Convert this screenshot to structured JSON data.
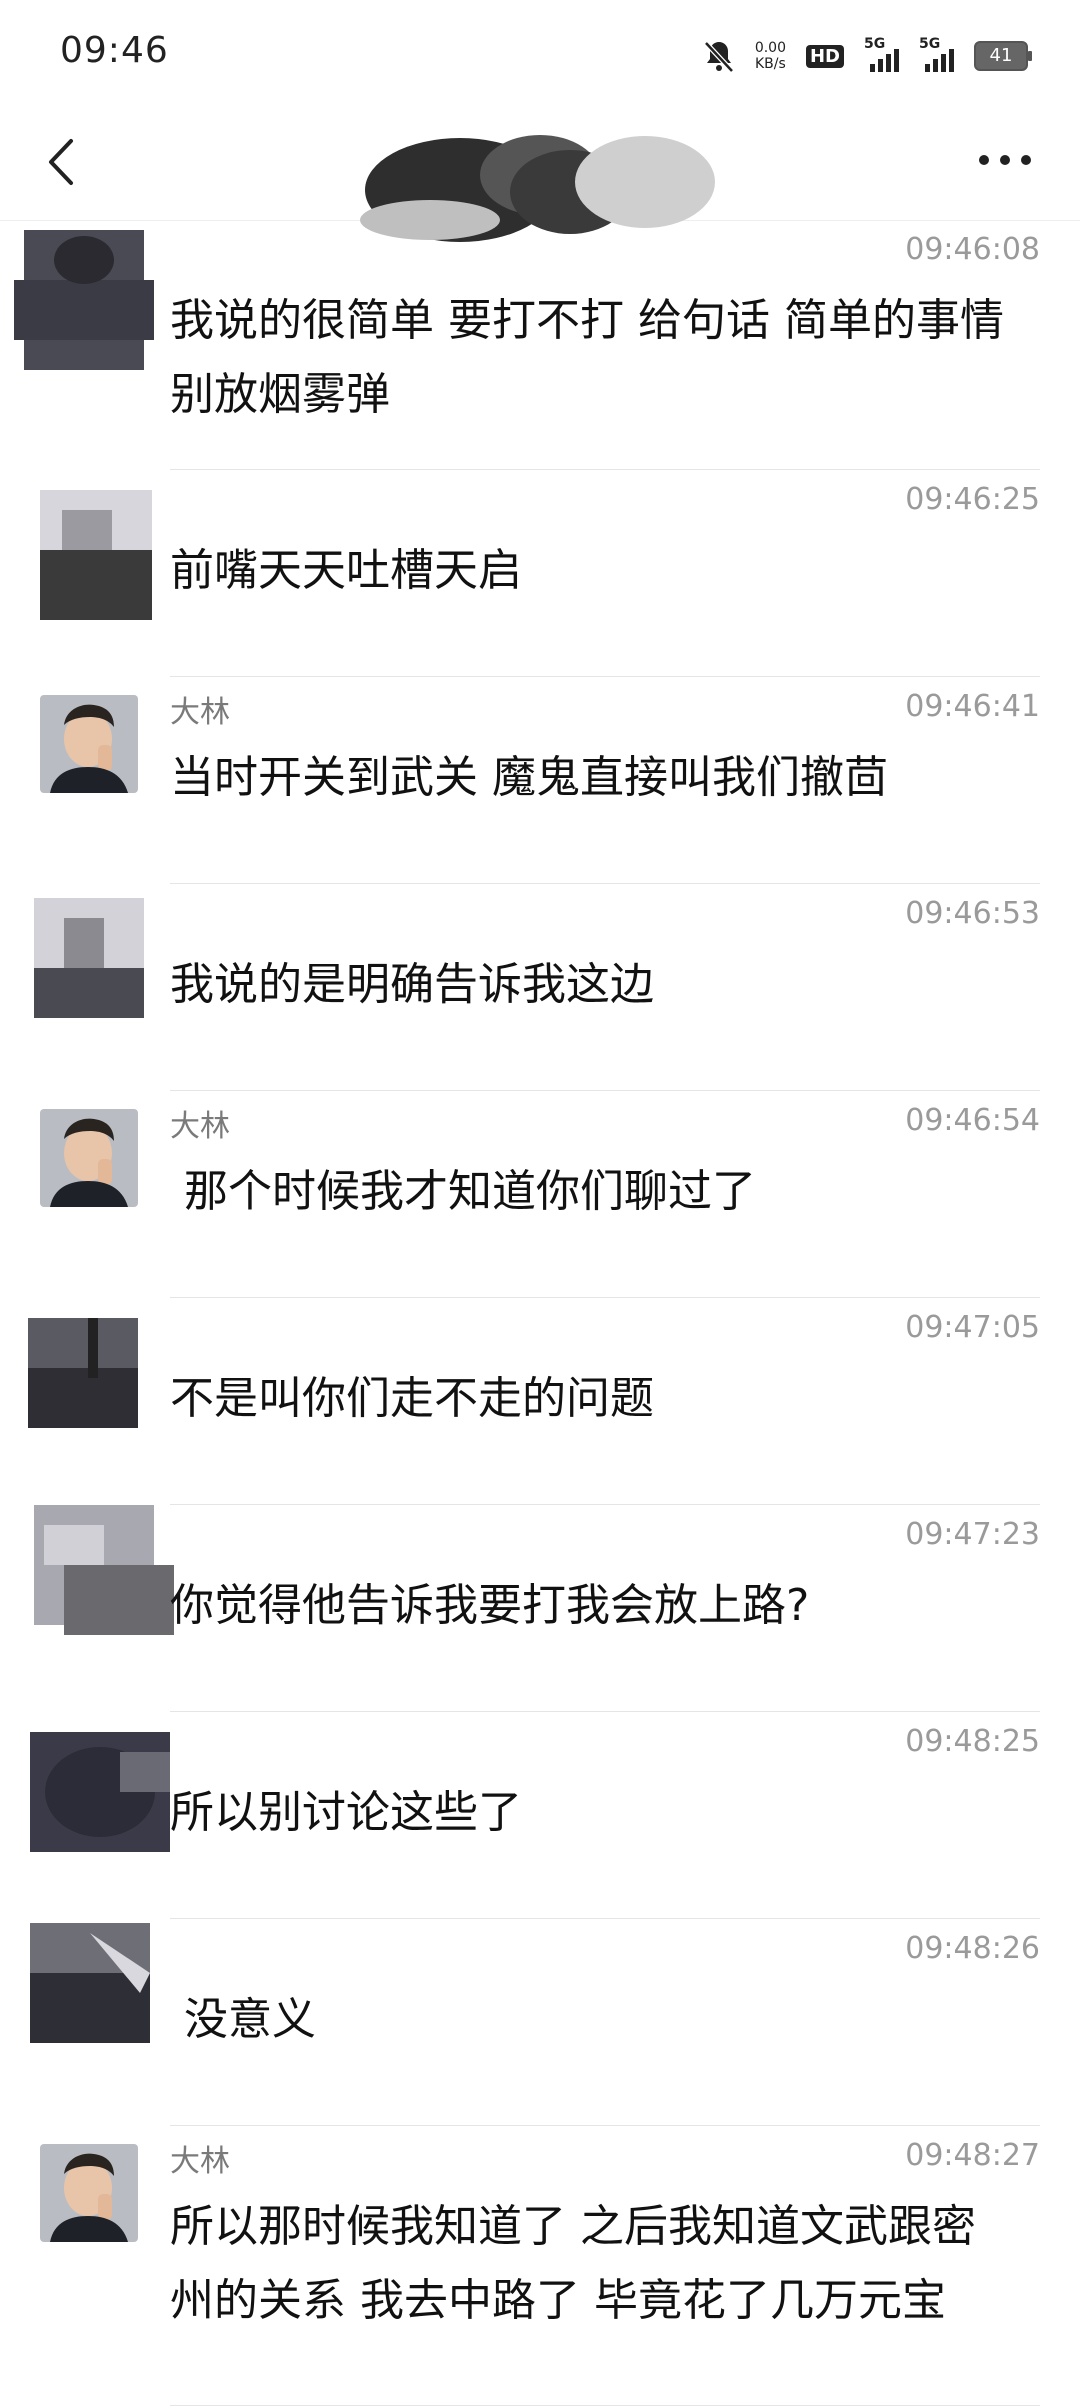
{
  "status_bar": {
    "time": "09:46",
    "net_speed": "0.00",
    "net_unit": "KB/s",
    "hd_label": "HD",
    "sim1_label": "5G",
    "sim2_label": "5G",
    "battery_level": "41"
  },
  "header": {
    "title_obscured": true,
    "back_icon": "chevron-left-icon",
    "more_icon": "more-horizontal-icon"
  },
  "messages": [
    {
      "name": "",
      "time": "09:46:08",
      "text": "我说的很简单 要打不打 给句话 简单的事情\n别放烟雾弹",
      "avatar": "scribbled"
    },
    {
      "name": "",
      "time": "09:46:25",
      "text": "前嘴天天吐槽天启",
      "avatar": "scribbled"
    },
    {
      "name": "大林",
      "time": "09:46:41",
      "text": "当时开关到武关 魔鬼直接叫我们撤茴",
      "avatar": "photo"
    },
    {
      "name": "",
      "time": "09:46:53",
      "text": "我说的是明确告诉我这边",
      "avatar": "scribbled"
    },
    {
      "name": "大林",
      "time": "09:46:54",
      "text": " 那个时候我才知道你们聊过了",
      "avatar": "photo"
    },
    {
      "name": "",
      "time": "09:47:05",
      "text": "不是叫你们走不走的问题",
      "avatar": "scribbled"
    },
    {
      "name": "",
      "time": "09:47:23",
      "text": "你觉得他告诉我要打我会放上路?",
      "avatar": "scribbled"
    },
    {
      "name": "",
      "time": "09:48:25",
      "text": "所以别讨论这些了",
      "avatar": "scribbled"
    },
    {
      "name": "",
      "time": "09:48:26",
      "text": " 没意义",
      "avatar": "scribbled"
    },
    {
      "name": "大林",
      "time": "09:48:27",
      "text": "所以那时候我知道了 之后我知道文武跟密\n州的关系 我去中路了 毕竟花了几万元宝",
      "avatar": "photo"
    }
  ],
  "colors": {
    "background": "#ffffff",
    "timestamp": "#9a9a9a",
    "name": "#7a7a7a",
    "text": "#111111",
    "divider": "#e5e5e5"
  }
}
